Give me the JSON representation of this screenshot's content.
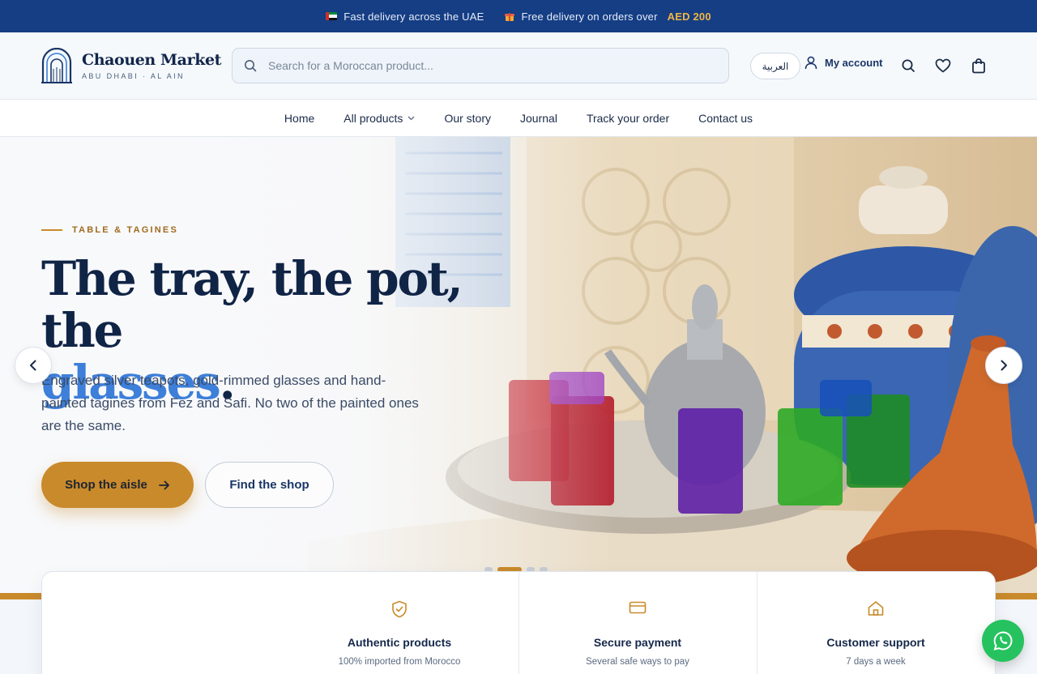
{
  "announcement": {
    "delivery_text": "Fast delivery across the UAE",
    "free_delivery_text": "Free delivery on orders over",
    "free_delivery_amount": "AED 200"
  },
  "brand": {
    "name": "Chaouen Market",
    "tagline": "ABU DHABI · AL AIN"
  },
  "search": {
    "placeholder": "Search for a Moroccan product..."
  },
  "header": {
    "language_label": "العربية",
    "account_label": "My account",
    "icons": [
      "user-icon",
      "search-icon",
      "heart-icon",
      "bag-icon"
    ]
  },
  "nav": {
    "items": [
      {
        "label": "Home"
      },
      {
        "label": "All products",
        "dropdown": true
      },
      {
        "label": "Our story"
      },
      {
        "label": "Journal"
      },
      {
        "label": "Track your order"
      },
      {
        "label": "Contact us"
      }
    ]
  },
  "hero": {
    "eyebrow": "TABLE & TAGINES",
    "headline_part1": "The tray, the pot, the",
    "headline_highlight": "glasses",
    "headline_end": ".",
    "description": "Engraved silver teapots, gold-rimmed glasses and hand-painted tagines from Fez and Safi. No two of the painted ones are the same.",
    "primary_cta": "Shop the aisle",
    "secondary_cta": "Find the shop",
    "slides_total": 4,
    "slide_active": 2
  },
  "features": [
    {
      "icon": "shield-check-icon",
      "title": "Authentic products",
      "subtitle": "100% imported from Morocco"
    },
    {
      "icon": "credit-card-icon",
      "title": "Secure payment",
      "subtitle": "Several safe ways to pay"
    },
    {
      "icon": "home-icon",
      "title": "Customer support",
      "subtitle": "7 days a week"
    }
  ],
  "colors": {
    "navy": "#153e84",
    "gold": "#c98a2b",
    "highlight_blue": "#3d7fd9",
    "whatsapp_green": "#26c25f"
  }
}
